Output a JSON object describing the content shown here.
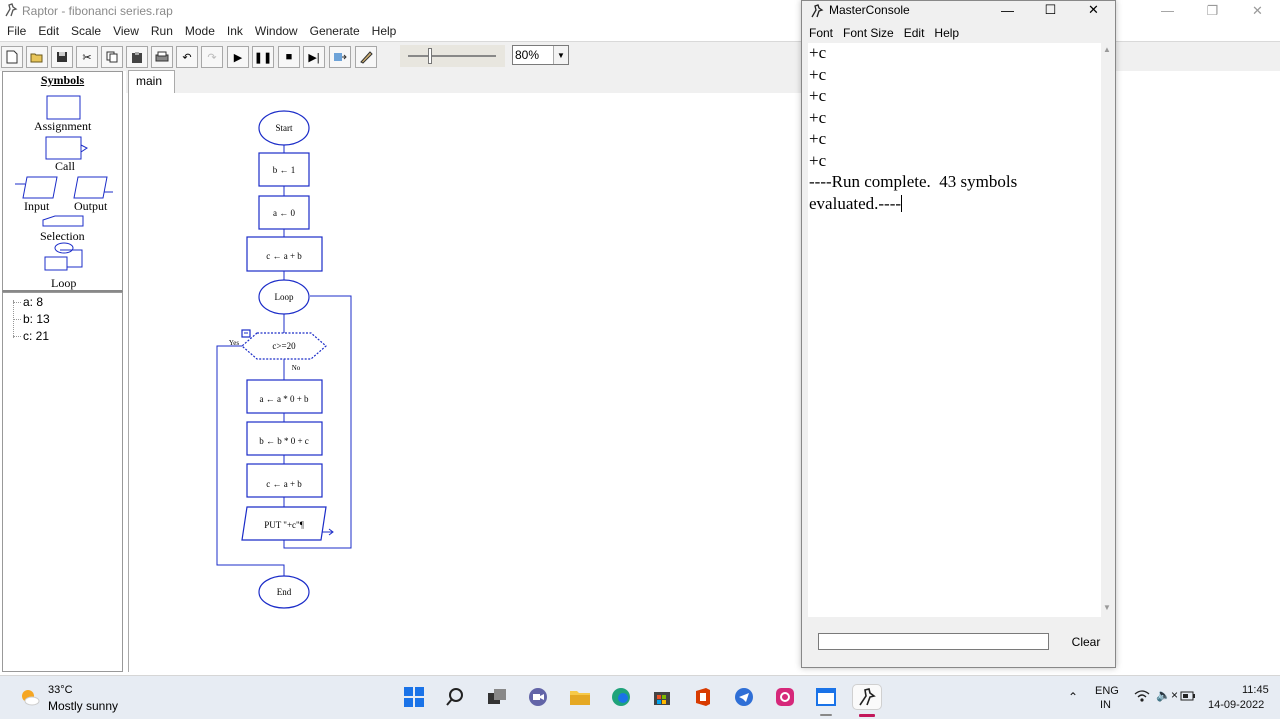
{
  "app": {
    "title": "Raptor - fibonanci series.rap",
    "menu": [
      "File",
      "Edit",
      "Scale",
      "View",
      "Run",
      "Mode",
      "Ink",
      "Window",
      "Generate",
      "Help"
    ],
    "zoom": "80%",
    "tab": "main"
  },
  "symbols_panel": {
    "header": "Symbols",
    "assignment": "Assignment",
    "call": "Call",
    "input": "Input",
    "output": "Output",
    "selection": "Selection",
    "loop": "Loop"
  },
  "variables": [
    "a: 8",
    "b: 13",
    "c: 21"
  ],
  "flowchart": {
    "start": "Start",
    "b_init": "b ← 1",
    "a_init": "a ← 0",
    "c_init": "c ← a + b",
    "loop": "Loop",
    "condition": "c>=20",
    "yes": "Yes",
    "no": "No",
    "a_update": "a ← a * 0 + b",
    "b_update": "b ← b * 0 + c",
    "c_update": "c ← a + b",
    "output": "PUT \"+c\"¶",
    "end": "End"
  },
  "console": {
    "title": "MasterConsole",
    "menu": [
      "Font",
      "Font Size",
      "Edit",
      "Help"
    ],
    "lines": [
      "+c",
      "+c",
      "+c",
      "+c",
      "+c",
      "+c",
      "----Run complete.  43 symbols",
      "evaluated.----"
    ],
    "clear": "Clear"
  },
  "taskbar": {
    "temp": "33°C",
    "weather": "Mostly sunny",
    "lang_top": "ENG",
    "lang_bottom": "IN",
    "time": "11:45",
    "date": "14-09-2022"
  }
}
